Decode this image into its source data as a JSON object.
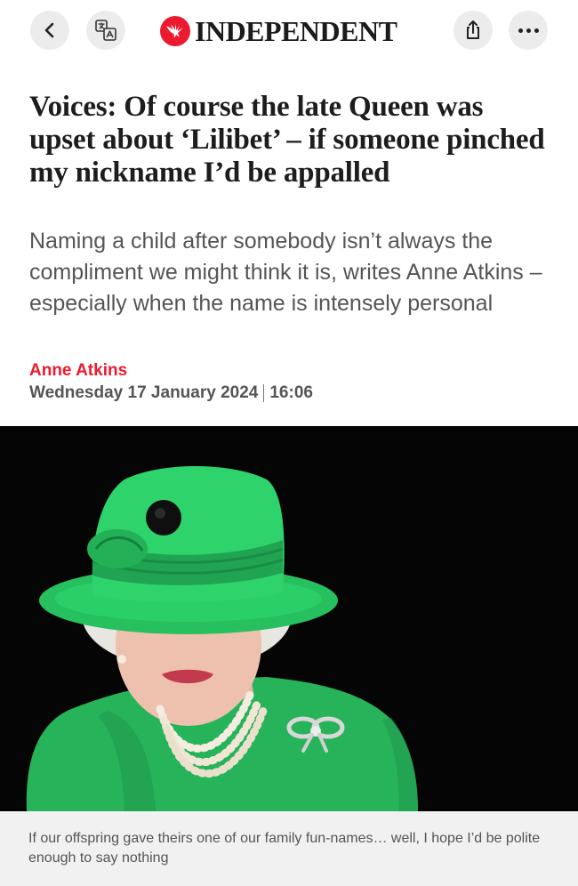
{
  "header": {
    "brand_name": "INDEPENDENT",
    "brand_color": "#ec1a2e",
    "icons": {
      "back": "chevron-left-icon",
      "translate": "translate-icon",
      "share": "share-icon",
      "more": "more-dots-icon",
      "logo": "eagle-logo-icon"
    }
  },
  "article": {
    "headline": "Voices: Of course the late Queen was upset about ‘Lilibet’ – if someone pinched my nickname I’d be appalled",
    "standfirst": "Naming a child after somebody isn’t always the compliment we might think it is, writes Anne Atkins – especially when the name is intensely personal",
    "author": "Anne Atkins",
    "date": "Wednesday 17 January 2024",
    "time": "16:06",
    "image_caption": "If our offspring gave theirs one of our family fun-names… well, I hope I’d be polite enough to say nothing"
  }
}
